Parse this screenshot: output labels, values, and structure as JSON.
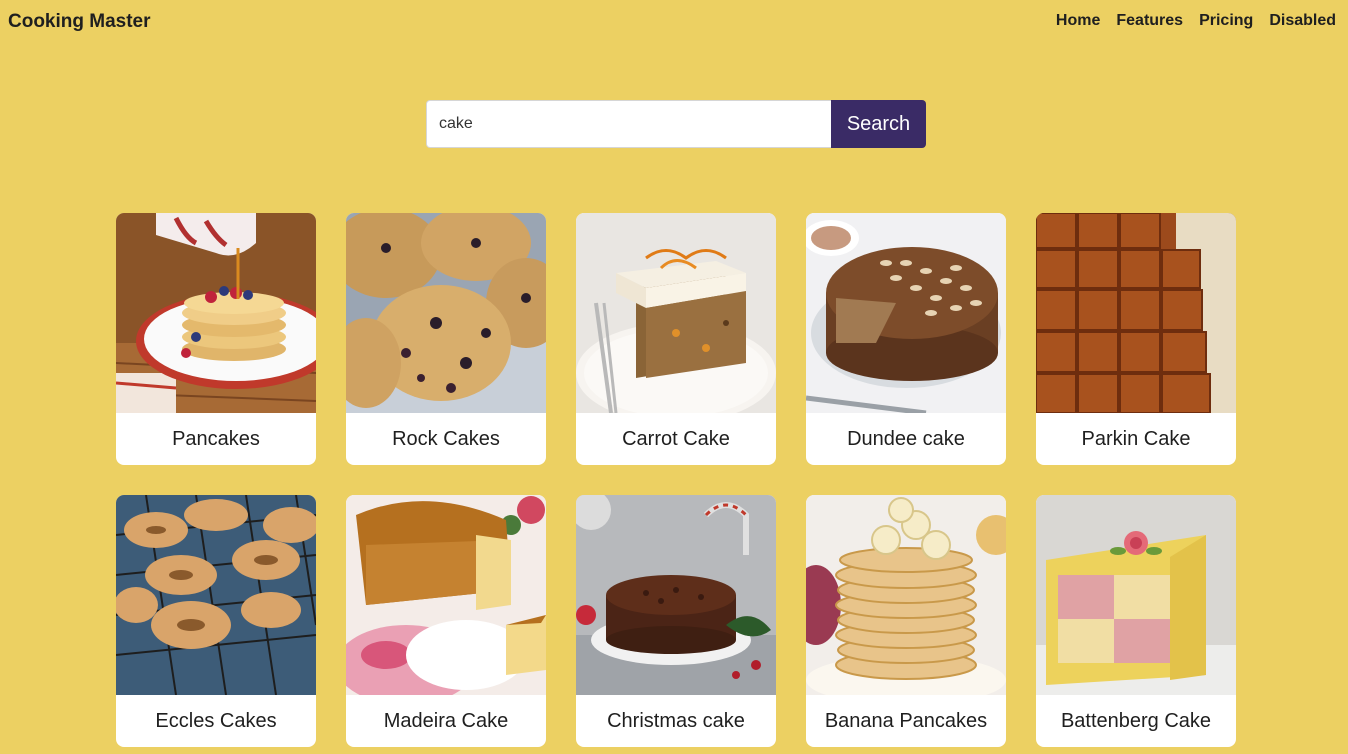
{
  "navbar": {
    "brand": "Cooking Master",
    "links": [
      "Home",
      "Features",
      "Pricing",
      "Disabled"
    ]
  },
  "search": {
    "value": "cake",
    "placeholder": "",
    "button_label": "Search"
  },
  "recipes": [
    {
      "title": "Pancakes",
      "image": "pancakes-photo"
    },
    {
      "title": "Rock Cakes",
      "image": "rock-cakes-photo"
    },
    {
      "title": "Carrot Cake",
      "image": "carrot-cake-photo"
    },
    {
      "title": "Dundee cake",
      "image": "dundee-cake-photo"
    },
    {
      "title": "Parkin Cake",
      "image": "parkin-cake-photo"
    },
    {
      "title": "Eccles Cakes",
      "image": "eccles-cakes-photo"
    },
    {
      "title": "Madeira Cake",
      "image": "madeira-cake-photo"
    },
    {
      "title": "Christmas cake",
      "image": "christmas-cake-photo"
    },
    {
      "title": "Banana Pancakes",
      "image": "banana-pancakes-photo"
    },
    {
      "title": "Battenberg Cake",
      "image": "battenberg-cake-photo"
    }
  ],
  "colors": {
    "background": "#ecd062",
    "search_button": "#3a2b66",
    "card": "#ffffff"
  }
}
